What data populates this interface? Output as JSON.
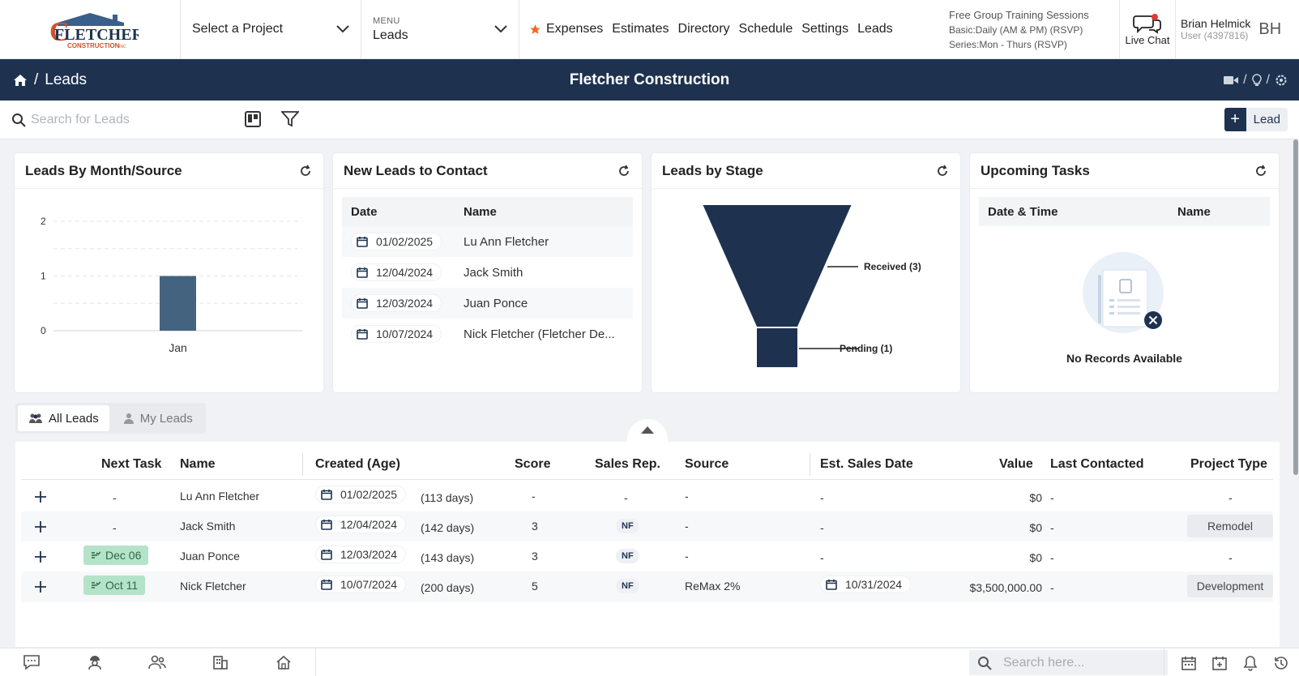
{
  "brand": {
    "logo_text_1": "FLETCHER",
    "logo_text_2": "CONSTRUCTION",
    "logo_sup": "INC"
  },
  "project_select": {
    "value": "Select a Project"
  },
  "menu": {
    "small_label": "MENU",
    "value": "Leads"
  },
  "nav": {
    "items": [
      "Expenses",
      "Estimates",
      "Directory",
      "Schedule",
      "Settings",
      "Leads"
    ]
  },
  "training": {
    "title": "Free Group Training Sessions",
    "line1": "Basic:Daily (AM & PM) (RSVP)",
    "line2": "Series:Mon - Thurs (RSVP)"
  },
  "livechat": {
    "label": "Live Chat"
  },
  "user": {
    "name": "Brian Helmick",
    "id": "User (4397816)",
    "initials": "BH"
  },
  "header": {
    "crumb_sep": "/",
    "page": "Leads",
    "company": "Fletcher Construction",
    "icon_sep": "/"
  },
  "search": {
    "placeholder": "Search for Leads"
  },
  "add_lead": {
    "label": "Lead"
  },
  "widgets": {
    "by_month": {
      "title": "Leads By Month/Source",
      "chart_data": {
        "type": "bar",
        "categories": [
          "Jan"
        ],
        "values": [
          1
        ],
        "title": "",
        "xlabel": "",
        "ylabel": "",
        "ylim": [
          0,
          2
        ],
        "yticks": [
          0,
          1,
          2
        ],
        "grid": true,
        "bar_color": "#44637f"
      }
    },
    "new_leads": {
      "title": "New Leads to Contact",
      "headers": [
        "Date",
        "Name"
      ],
      "rows": [
        {
          "date": "01/02/2025",
          "name": "Lu Ann Fletcher"
        },
        {
          "date": "12/04/2024",
          "name": "Jack Smith"
        },
        {
          "date": "12/03/2024",
          "name": "Juan Ponce"
        },
        {
          "date": "10/07/2024",
          "name": "Nick Fletcher (Fletcher De..."
        }
      ]
    },
    "by_stage": {
      "title": "Leads by Stage",
      "chart_data": {
        "type": "funnel",
        "stages": [
          {
            "name": "Received",
            "value": 3,
            "label": "Received (3)"
          },
          {
            "name": "Pending",
            "value": 1,
            "label": "Pending (1)"
          }
        ],
        "color": "#1e3250"
      }
    },
    "tasks": {
      "title": "Upcoming Tasks",
      "headers": [
        "Date & Time",
        "Name"
      ],
      "empty": "No Records Available"
    }
  },
  "tabs": {
    "all": "All Leads",
    "mine": "My Leads"
  },
  "table": {
    "headers": [
      "Next Task",
      "Name",
      "Created (Age)",
      "Score",
      "Sales Rep.",
      "Source",
      "Est. Sales Date",
      "Value",
      "Last Contacted",
      "Project Type"
    ],
    "rows": [
      {
        "task": "-",
        "name": "Lu Ann Fletcher",
        "created": "01/02/2025",
        "age": "(113 days)",
        "score": "-",
        "rep": "-",
        "source": "-",
        "est": "-",
        "value": "$0",
        "last": "-",
        "ptype": "-"
      },
      {
        "task": "-",
        "name": "Jack Smith",
        "created": "12/04/2024",
        "age": "(142 days)",
        "score": "3",
        "rep": "NF",
        "source": "-",
        "est": "-",
        "value": "$0",
        "last": "-",
        "ptype": "Remodel"
      },
      {
        "task": "Dec 06",
        "name": "Juan Ponce",
        "created": "12/03/2024",
        "age": "(143 days)",
        "score": "3",
        "rep": "NF",
        "source": "-",
        "est": "-",
        "value": "$0",
        "last": "-",
        "ptype": "-"
      },
      {
        "task": "Oct 11",
        "name": "Nick Fletcher",
        "created": "10/07/2024",
        "age": "(200 days)",
        "score": "5",
        "rep": "NF",
        "source": "ReMax 2%",
        "est": "10/31/2024",
        "value": "$3,500,000.00",
        "last": "-",
        "ptype": "Development"
      }
    ]
  },
  "bottom": {
    "search_placeholder": "Search here..."
  },
  "colors": {
    "navy": "#1e3250",
    "star": "#f26522",
    "task_bg": "#b5e3c9"
  }
}
